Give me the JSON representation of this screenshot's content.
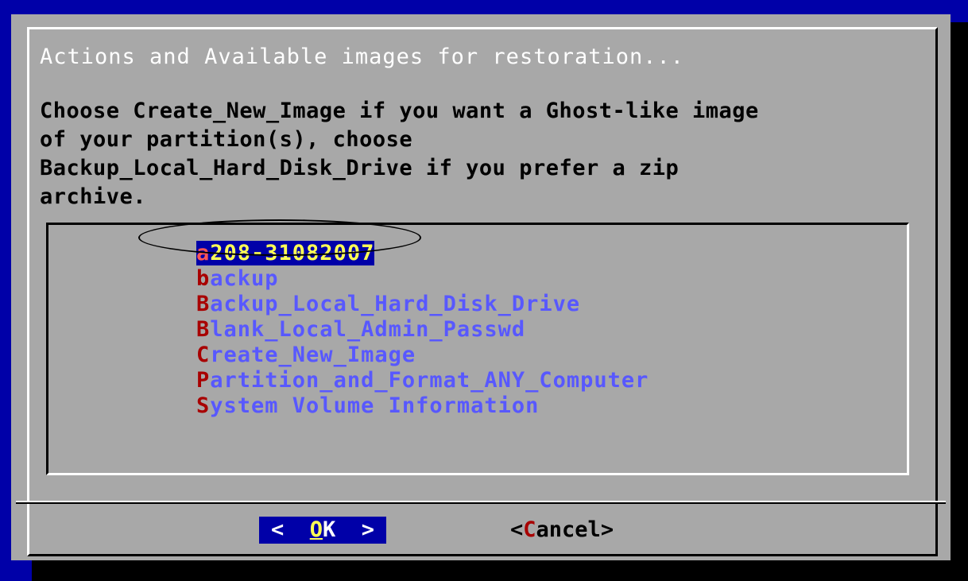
{
  "dialog": {
    "title": "Actions and Available images for restoration...",
    "prompt": "Choose Create_New_Image if you want a Ghost-like image\nof your partition(s), choose\nBackup_Local_Hard_Disk_Drive if you prefer a zip\narchive."
  },
  "list": {
    "selected_index": 0,
    "items": [
      {
        "hotkey": "a",
        "rest": "208-31082007"
      },
      {
        "hotkey": "b",
        "rest": "ackup"
      },
      {
        "hotkey": "B",
        "rest": "ackup_Local_Hard_Disk_Drive"
      },
      {
        "hotkey": "B",
        "rest": "lank_Local_Admin_Passwd"
      },
      {
        "hotkey": "C",
        "rest": "reate_New_Image"
      },
      {
        "hotkey": "P",
        "rest": "artition_and_Format_ANY_Computer"
      },
      {
        "hotkey": "S",
        "rest": "ystem Volume Information"
      }
    ]
  },
  "buttons": {
    "ok": {
      "left": "<  ",
      "hotkey": "O",
      "rest": "K",
      "right": "  >"
    },
    "cancel": {
      "left": "<",
      "hotkey": "C",
      "rest": "ancel",
      "right": ">"
    }
  },
  "colors": {
    "screen": "#0000a8",
    "dialog": "#a8a8a8",
    "item": "#5858ff",
    "hotkey": "#a80000",
    "selected_bg": "#0000a8",
    "selected_fg": "#ffff55"
  }
}
